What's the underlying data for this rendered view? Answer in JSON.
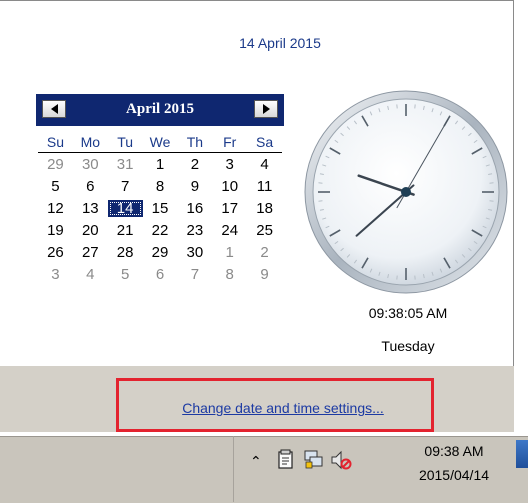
{
  "header": {
    "date_long": "14 April 2015"
  },
  "calendar": {
    "month_label": "April 2015",
    "weekdays": [
      "Su",
      "Mo",
      "Tu",
      "We",
      "Th",
      "Fr",
      "Sa"
    ],
    "weeks": [
      [
        {
          "d": "29",
          "other": true
        },
        {
          "d": "30",
          "other": true
        },
        {
          "d": "31",
          "other": true
        },
        {
          "d": "1"
        },
        {
          "d": "2"
        },
        {
          "d": "3"
        },
        {
          "d": "4"
        }
      ],
      [
        {
          "d": "5"
        },
        {
          "d": "6"
        },
        {
          "d": "7"
        },
        {
          "d": "8"
        },
        {
          "d": "9"
        },
        {
          "d": "10"
        },
        {
          "d": "11"
        }
      ],
      [
        {
          "d": "12"
        },
        {
          "d": "13"
        },
        {
          "d": "14",
          "today": true
        },
        {
          "d": "15"
        },
        {
          "d": "16"
        },
        {
          "d": "17"
        },
        {
          "d": "18"
        }
      ],
      [
        {
          "d": "19"
        },
        {
          "d": "20"
        },
        {
          "d": "21"
        },
        {
          "d": "22"
        },
        {
          "d": "23"
        },
        {
          "d": "24"
        },
        {
          "d": "25"
        }
      ],
      [
        {
          "d": "26"
        },
        {
          "d": "27"
        },
        {
          "d": "28"
        },
        {
          "d": "29"
        },
        {
          "d": "30"
        },
        {
          "d": "1",
          "other": true
        },
        {
          "d": "2",
          "other": true
        }
      ],
      [
        {
          "d": "3",
          "other": true
        },
        {
          "d": "4",
          "other": true
        },
        {
          "d": "5",
          "other": true
        },
        {
          "d": "6",
          "other": true
        },
        {
          "d": "7",
          "other": true
        },
        {
          "d": "8",
          "other": true
        },
        {
          "d": "9",
          "other": true
        }
      ]
    ],
    "header_color": "#0f2770",
    "prev_icon": "triangle-left-icon",
    "next_icon": "triangle-right-icon"
  },
  "clock": {
    "time": "09:38:05 AM",
    "weekday": "Tuesday",
    "hands": {
      "hour": 9,
      "minute": 38,
      "second": 5
    }
  },
  "footer": {
    "settings_link": "Change date and time settings...",
    "highlight_color": "#e3232f"
  },
  "taskbar": {
    "tray_icons": [
      "show-hidden-icons-chevron",
      "action-center-flag-icon",
      "network-icon",
      "speaker-muted-icon"
    ],
    "time": "09:38 AM",
    "date": "2015/04/14"
  }
}
